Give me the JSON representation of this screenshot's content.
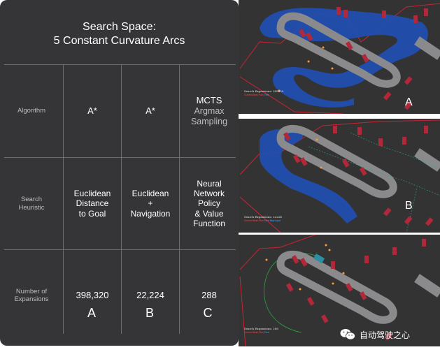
{
  "table": {
    "title_line1": "Search Space:",
    "title_line2": "5 Constant Curvature Arcs",
    "rows": [
      {
        "header": "Algorithm",
        "cells": [
          {
            "text": "A*"
          },
          {
            "text": "A*"
          },
          {
            "line1": "MCTS",
            "line2": "Argmax",
            "line3": "Sampling"
          }
        ]
      },
      {
        "header_line1": "Search",
        "header_line2": "Heuristic",
        "cells": [
          {
            "line1": "Euclidean",
            "line2": "Distance",
            "line3": "to Goal"
          },
          {
            "line1": "Euclidean",
            "line2": "+",
            "line3": "Navigation"
          },
          {
            "line1": "Neural",
            "line2": "Network",
            "line3": "Policy",
            "line4": "& Value",
            "line5": "Function"
          }
        ]
      },
      {
        "header_line1": "Number of",
        "header_line2": "Expansions",
        "cells": [
          {
            "text": "398,320",
            "value": 398320
          },
          {
            "text": "22,224",
            "value": 22224
          },
          {
            "text": "288",
            "value": 288
          }
        ]
      }
    ],
    "column_letters": [
      "A",
      "B",
      "C"
    ]
  },
  "maps": [
    {
      "letter": "A",
      "caption": "Search Expansions: 398320",
      "legend": [
        "Current",
        "Best Plan",
        "Tree"
      ],
      "legend_colors": [
        "#ff4444",
        "#ff4444",
        "#4ba3ff"
      ]
    },
    {
      "letter": "B",
      "caption": "Search Expansions: 22224",
      "legend": [
        "Current",
        "Best Plan",
        "Tree",
        "Map Input"
      ],
      "legend_colors": [
        "#ff4444",
        "#ff4444",
        "#4ba3ff",
        "#4ba3ff"
      ]
    },
    {
      "letter": "",
      "caption": "Search Expansions: 288",
      "legend": [
        "Current",
        "Best Plan",
        "Tree"
      ],
      "legend_colors": [
        "#ff4444",
        "#ff4444",
        "#4ba3ff"
      ]
    }
  ],
  "watermark": "自动驾驶之心",
  "colors": {
    "table_bg": "#353537",
    "map_bg": "#333333",
    "tree_blue": "#1f4fb4",
    "vehicle_red": "#b0283a",
    "boundary_red": "#cc2233",
    "road_gray": "#8a8a8c"
  }
}
